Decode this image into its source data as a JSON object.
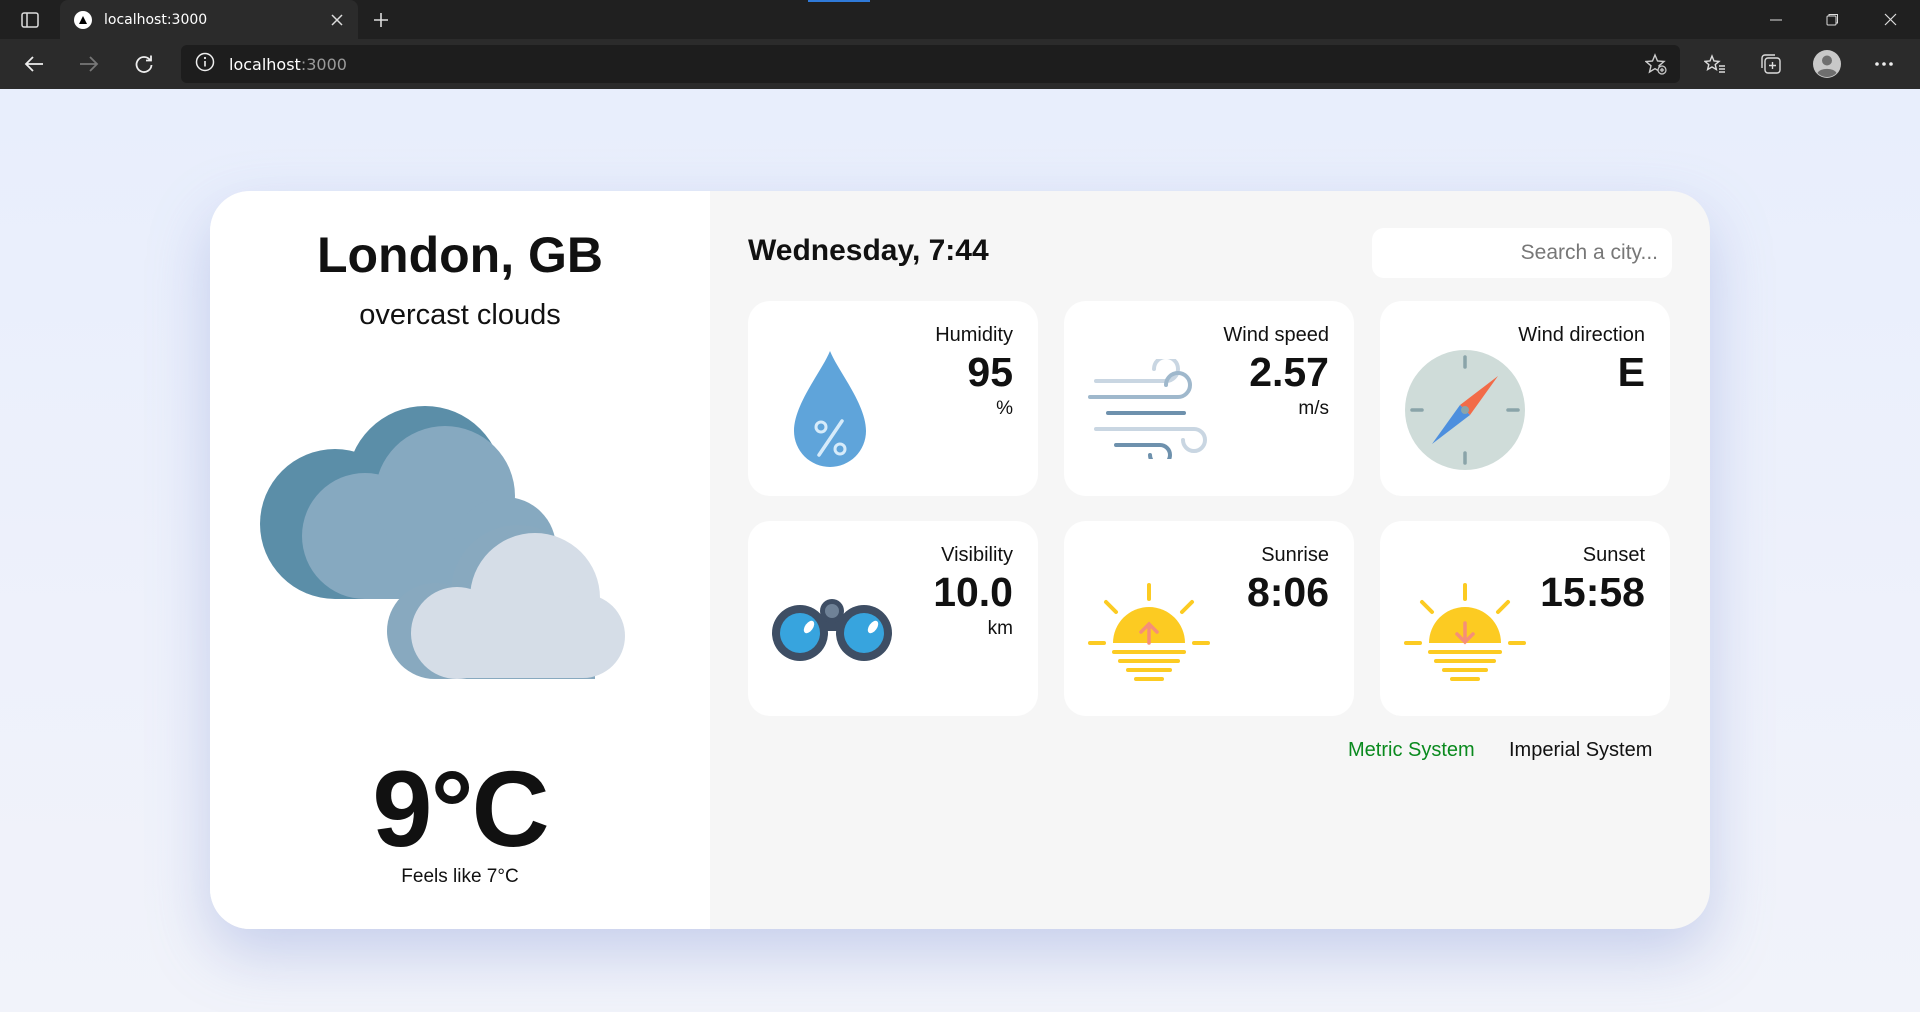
{
  "browser": {
    "tab_title": "localhost:3000",
    "address_host": "localhost",
    "address_port": ":3000",
    "icons": [
      "tab-actions-icon",
      "logo-icon",
      "close-icon",
      "plus-icon",
      "minimize-icon",
      "restore-icon",
      "close-window-icon",
      "back-icon",
      "forward-icon",
      "refresh-icon",
      "info-icon",
      "add-favorite-icon",
      "favorites-icon",
      "collections-icon",
      "profile-icon",
      "more-icon"
    ]
  },
  "weather": {
    "city": "London, GB",
    "description": "overcast clouds",
    "temperature": "9°C",
    "feels_like": "Feels like 7°C",
    "date_time": "Wednesday, 7:44",
    "search_placeholder": "Search a city...",
    "tiles": [
      {
        "title": "Humidity",
        "value": "95",
        "unit": "%",
        "icon": "humidity-drop-icon"
      },
      {
        "title": "Wind speed",
        "value": "2.57",
        "unit": "m/s",
        "icon": "wind-icon"
      },
      {
        "title": "Wind direction",
        "value": "E",
        "unit": "",
        "icon": "compass-icon"
      },
      {
        "title": "Visibility",
        "value": "10.0",
        "unit": "km",
        "icon": "binoculars-icon"
      },
      {
        "title": "Sunrise",
        "value": "8:06",
        "unit": "",
        "icon": "sunrise-icon"
      },
      {
        "title": "Sunset",
        "value": "15:58",
        "unit": "",
        "icon": "sunset-icon"
      }
    ],
    "units": {
      "metric": "Metric System",
      "imperial": "Imperial System"
    },
    "colors": {
      "metric_active": "#0a8a1e",
      "accent_blue": "#2f7ad8"
    }
  }
}
